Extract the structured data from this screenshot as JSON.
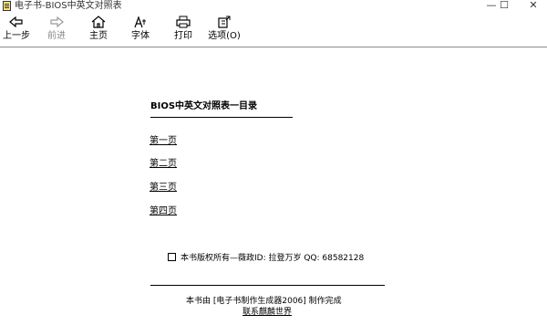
{
  "window": {
    "title": "电子书-BIOS中英文对照表",
    "minimize": "—",
    "maximize": "☐",
    "close": "✕"
  },
  "toolbar": {
    "back": "上一步",
    "forward": "前进",
    "home": "主页",
    "font": "字体",
    "print": "打印",
    "options": "选项(O)"
  },
  "page": {
    "title": "BIOS中英文对照表一目录",
    "toc": [
      "第一页",
      "第二页",
      "第三页",
      "第四页"
    ],
    "copyright": "本书版权所有—薇政ID: 拉登万岁 QQ: 68582128",
    "footer_text": "本书由 [电子书制作生成器2006] 制作完成",
    "footer_link": "联系麒麟世界"
  },
  "colors": {
    "background": "#ffffff",
    "text": "#000000",
    "disabled": "#8a8a8a"
  }
}
